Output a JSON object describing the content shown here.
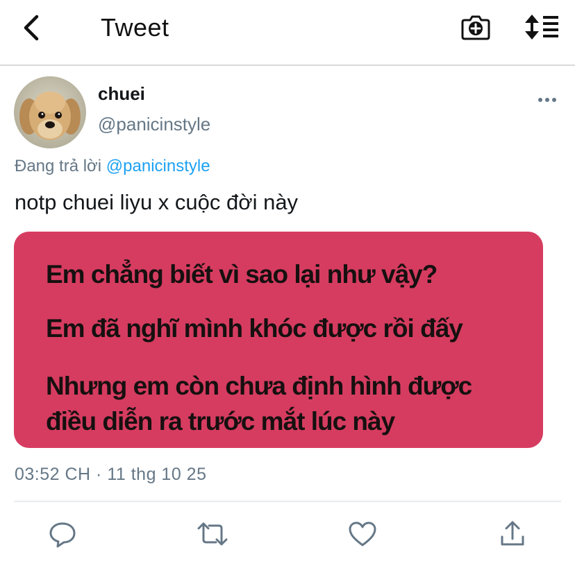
{
  "header": {
    "title": "Tweet",
    "back_icon": "chevron-left-icon",
    "camera_icon": "camera-plus-icon",
    "sort_icon": "sort-list-icon"
  },
  "tweet": {
    "author": {
      "display_name": "chuei",
      "handle": "@panicinstyle",
      "avatar": "puppy-photo"
    },
    "reply_prefix": "Đang trả lời",
    "reply_to": "@panicinstyle",
    "text": "notp chuei liyu x cuộc đời này",
    "media": {
      "background": "#d63c60",
      "lines": [
        "Em chẳng biết vì sao lại như vậy?",
        "Em đã nghĩ mình khóc được rồi đấy",
        "Nhưng em còn chưa định hình được",
        "điều diễn ra trước mắt lúc này"
      ]
    },
    "timestamp": "03:52 CH · 11 thg 10 25"
  },
  "actions": {
    "reply_icon": "reply-bubble-icon",
    "retweet_icon": "retweet-icon",
    "like_icon": "heart-icon",
    "share_icon": "share-icon"
  },
  "colors": {
    "accent": "#1da1f2",
    "secondary_text": "#657786",
    "media_pink": "#d63c60"
  }
}
